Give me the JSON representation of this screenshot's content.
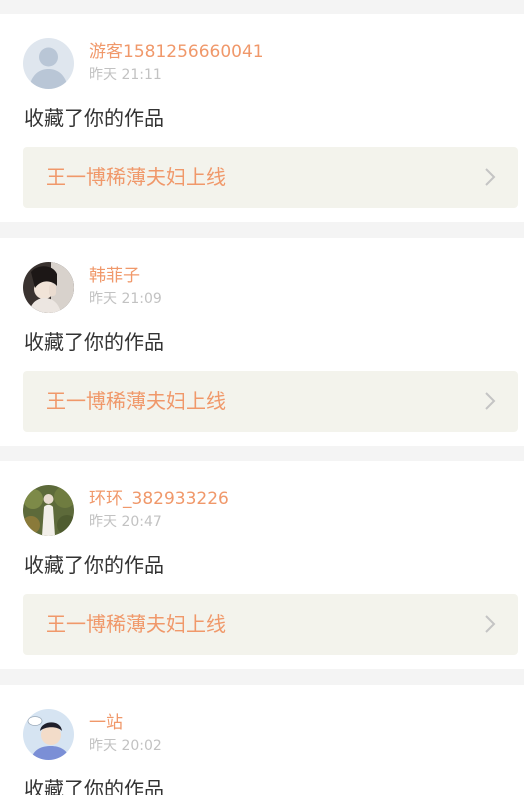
{
  "feed": {
    "items": [
      {
        "username": "游客1581256660041",
        "time": "昨天 21:11",
        "action": "收藏了你的作品",
        "work_title": "王一博稀薄夫妇上线",
        "avatar_icon": "default-user-icon"
      },
      {
        "username": "韩菲子",
        "time": "昨天 21:09",
        "action": "收藏了你的作品",
        "work_title": "王一博稀薄夫妇上线",
        "avatar_icon": "user-photo"
      },
      {
        "username": "环环_382933226",
        "time": "昨天 20:47",
        "action": "收藏了你的作品",
        "work_title": "王一博稀薄夫妇上线",
        "avatar_icon": "user-photo"
      },
      {
        "username": "一站",
        "time": "昨天 20:02",
        "action": "收藏了你的作品",
        "avatar_icon": "user-photo"
      }
    ]
  },
  "colors": {
    "accent": "#f0986a",
    "muted": "#c2c2c2",
    "text": "#333333",
    "link_bg": "#f3f3ec",
    "page_bg": "#f4f4f4"
  },
  "icons": {
    "chevron": "chevron-right-icon"
  }
}
